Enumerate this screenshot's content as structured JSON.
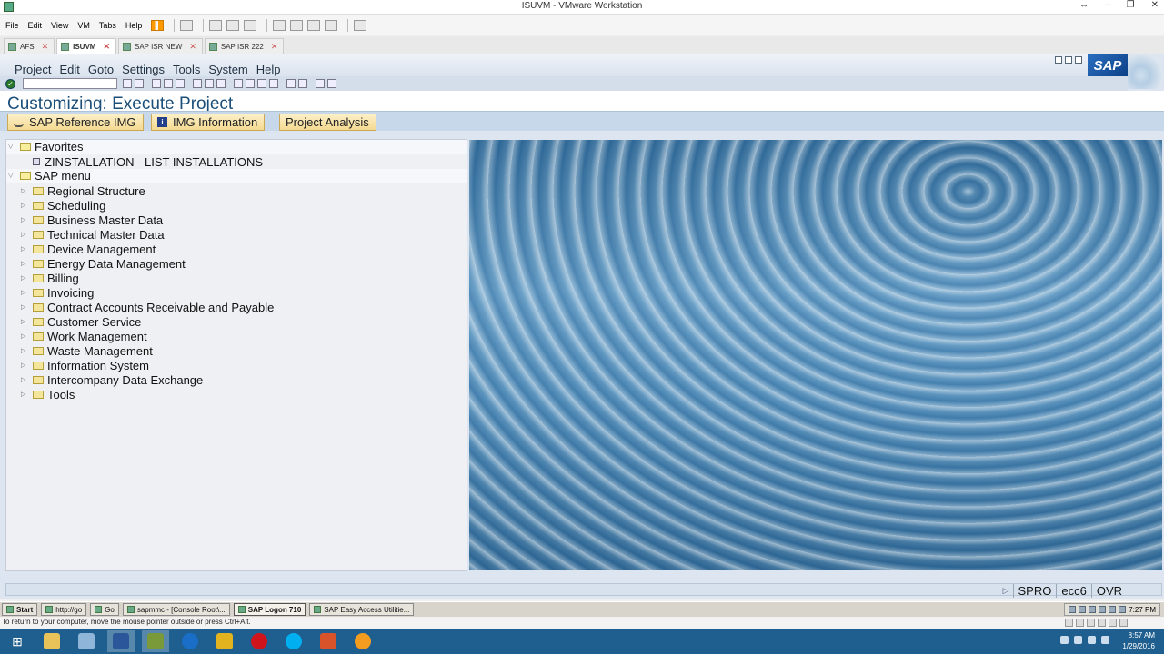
{
  "window": {
    "title": "ISUVM - VMware Workstation",
    "controls": [
      "↔",
      "–",
      "❐",
      "✕"
    ]
  },
  "vmware_menu": [
    "File",
    "Edit",
    "View",
    "VM",
    "Tabs",
    "Help"
  ],
  "vm_tabs": [
    {
      "label": "AFS",
      "active": false
    },
    {
      "label": "ISUVM",
      "active": true
    },
    {
      "label": "SAP ISR NEW",
      "active": false
    },
    {
      "label": "SAP ISR 222",
      "active": false
    }
  ],
  "sap": {
    "menu": [
      "Project",
      "Edit",
      "Goto",
      "Settings",
      "Tools",
      "System",
      "Help"
    ],
    "logo": "SAP",
    "page_title": "Customizing: Execute Project",
    "app_buttons": [
      {
        "label": "SAP Reference IMG",
        "icon": "glasses-icon"
      },
      {
        "label": "IMG Information",
        "icon": "info-icon"
      },
      {
        "label": "Project Analysis",
        "icon": ""
      }
    ],
    "tree": {
      "favorites": {
        "label": "Favorites",
        "items": [
          "ZINSTALLATION - LIST INSTALLATIONS"
        ]
      },
      "sap_menu": {
        "label": "SAP menu",
        "items": [
          "Regional Structure",
          "Scheduling",
          "Business Master Data",
          "Technical Master Data",
          "Device Management",
          "Energy Data Management",
          "Billing",
          "Invoicing",
          "Contract Accounts Receivable and Payable",
          "Customer Service",
          "Work Management",
          "Waste Management",
          "Information System",
          "Intercompany Data Exchange",
          "Tools"
        ]
      }
    },
    "status": {
      "transaction": "SPRO",
      "system": "ecc6",
      "mode": "OVR"
    }
  },
  "guest_taskbar": {
    "start": "Start",
    "items": [
      {
        "label": "http://go",
        "active": false
      },
      {
        "label": "Go",
        "active": false
      },
      {
        "label": "sapmmc - [Console Root\\...",
        "active": false
      },
      {
        "label": "SAP Logon 710",
        "active": true
      },
      {
        "label": "SAP Easy Access  Utilitie...",
        "active": false
      }
    ],
    "clock": "7:27 PM"
  },
  "hint": "To return to your computer, move the mouse pointer outside or press Ctrl+Alt.",
  "host_clock": {
    "time": "8:57 AM",
    "date": "1/29/2016"
  }
}
